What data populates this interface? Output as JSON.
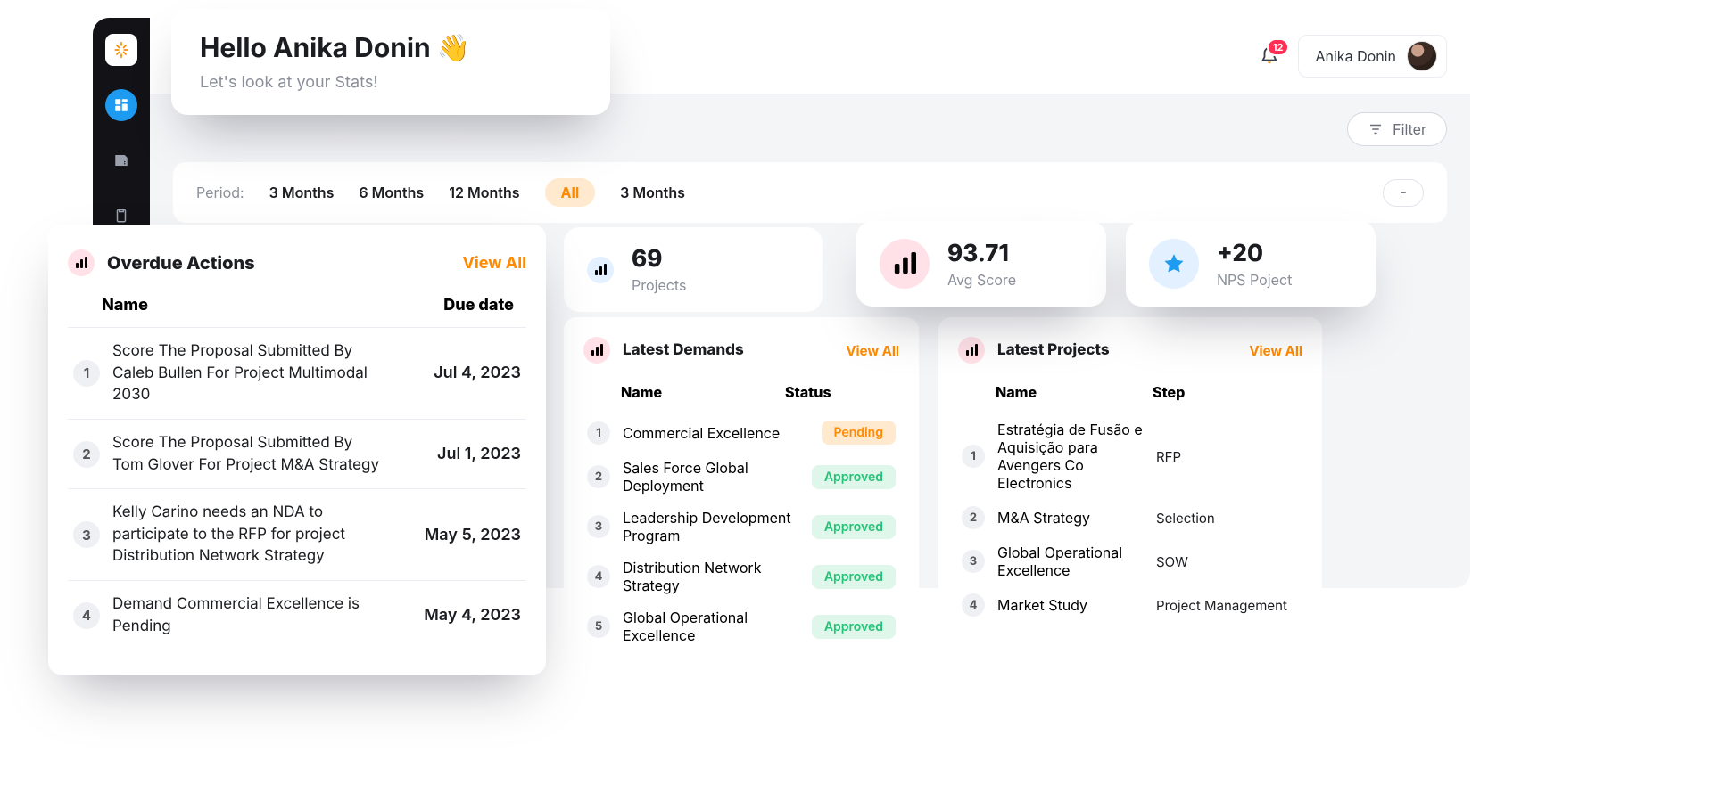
{
  "user": {
    "name": "Anika Donin"
  },
  "notifications": {
    "count": "12"
  },
  "greeting": {
    "title": "Hello Anika Donin 👋",
    "subtitle": "Let's look at your Stats!"
  },
  "filter": {
    "label": "Filter"
  },
  "period": {
    "label": "Period:",
    "options": [
      "3 Months",
      "6 Months",
      "12 Months"
    ],
    "active": "All",
    "display": "3 Months",
    "trailing": "-"
  },
  "kpi": {
    "projects": {
      "value": "69",
      "label": "Projects"
    },
    "avg": {
      "value": "93.71",
      "label": "Avg Score"
    },
    "nps": {
      "value": "+20",
      "label": "NPS Poject"
    }
  },
  "overdue": {
    "title": "Overdue Actions",
    "view_all": "View All",
    "cols": {
      "name": "Name",
      "due": "Due date"
    },
    "rows": [
      {
        "n": "1",
        "name": "Score The Proposal Submitted By Caleb Bullen For Project Multimodal 2030",
        "due": "Jul 4, 2023"
      },
      {
        "n": "2",
        "name": "Score The Proposal Submitted By Tom Glover For Project M&A Strategy",
        "due": "Jul 1, 2023"
      },
      {
        "n": "3",
        "name": "Kelly Carino needs an NDA to participate to the RFP for project Distribution Network Strategy",
        "due": "May 5, 2023"
      },
      {
        "n": "4",
        "name": "Demand Commercial Excellence is Pending",
        "due": "May 4, 2023"
      }
    ]
  },
  "demands": {
    "title": "Latest Demands",
    "view_all": "View All",
    "cols": {
      "name": "Name",
      "status": "Status"
    },
    "rows": [
      {
        "n": "1",
        "name": "Commercial Excellence",
        "status": "Pending"
      },
      {
        "n": "2",
        "name": "Sales Force Global Deployment",
        "status": "Approved"
      },
      {
        "n": "3",
        "name": "Leadership Development Program",
        "status": "Approved"
      },
      {
        "n": "4",
        "name": "Distribution Network Strategy",
        "status": "Approved"
      },
      {
        "n": "5",
        "name": "Global Operational Excellence",
        "status": "Approved"
      }
    ]
  },
  "projects": {
    "title": "Latest Projects",
    "view_all": "View All",
    "cols": {
      "name": "Name",
      "step": "Step"
    },
    "rows": [
      {
        "n": "1",
        "name": "Estratégia de Fusão e Aquisição para Avengers Co Electronics",
        "step": "RFP"
      },
      {
        "n": "2",
        "name": "M&A Strategy",
        "step": "Selection"
      },
      {
        "n": "3",
        "name": "Global Operational Excellence",
        "step": "SOW"
      },
      {
        "n": "4",
        "name": "Market Study",
        "step": "Project Management"
      }
    ]
  }
}
